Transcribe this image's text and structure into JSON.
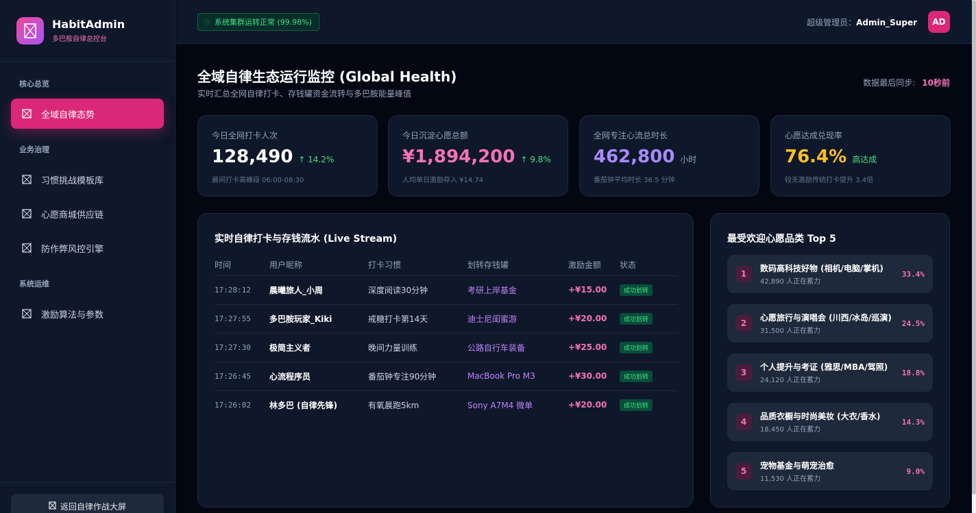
{
  "brand": {
    "title": "HabitAdmin",
    "subtitle": "多巴胺自律总控台"
  },
  "sidebar": {
    "sections": [
      "核心总览",
      "业务治理",
      "系统运维"
    ],
    "items": [
      {
        "label": "全域自律态势",
        "active": true
      },
      {
        "label": "习惯挑战模板库"
      },
      {
        "label": "心愿商城供应链"
      },
      {
        "label": "防作弊风控引擎"
      },
      {
        "label": "激励算法与参数"
      }
    ],
    "footer_button": "返回自律作战大屏"
  },
  "topbar": {
    "status": "系统集群运转正常 (99.98%)",
    "admin_label": "超级管理员：",
    "admin_name": "Admin_Super",
    "avatar": "AD"
  },
  "header": {
    "title": "全域自律生态运行监控 (Global Health)",
    "subtitle": "实时汇总全网自律打卡、存钱罐资金流转与多巴胺能量峰值",
    "sync_label": "数据最后同步:",
    "sync_value": "10秒前"
  },
  "kpis": [
    {
      "label": "今日全网打卡人次",
      "value": "128,490",
      "delta": "↑ 14.2%",
      "note": "晨间打卡高峰段 06:00-08:30",
      "color": "#ffffff",
      "delta_color": "#4ade80"
    },
    {
      "label": "今日沉淀心愿总额",
      "value": "¥1,894,200",
      "delta": "↑ 9.8%",
      "note": "人均单日激励存入 ¥14.74",
      "color": "#f472b6",
      "delta_color": "#4ade80"
    },
    {
      "label": "全网专注心流总时长",
      "value": "462,800",
      "delta": "小时",
      "note": "番茄钟平均时长 36.5 分钟",
      "color": "#a78bfa",
      "delta_color": "#94a3b8"
    },
    {
      "label": "心愿达成兑现率",
      "value": "76.4%",
      "delta": "高达成",
      "note": "较无激励传统打卡提升 3.4倍",
      "color": "#fbbf24",
      "delta_color": "#4ade80"
    }
  ],
  "stream": {
    "title": "实时自律打卡与存钱流水 (Live Stream)",
    "columns": [
      "时间",
      "用户昵称",
      "打卡习惯",
      "划转存钱罐",
      "激励金额",
      "状态"
    ],
    "rows": [
      {
        "time": "17:28:12",
        "user": "晨曦旅人_小周",
        "habit": "深度阅读30分钟",
        "jar": "考研上岸基金",
        "amount": "+¥15.00",
        "status": "成功划转"
      },
      {
        "time": "17:27:55",
        "user": "多巴胺玩家_Kiki",
        "habit": "戒糖打卡第14天",
        "jar": "迪士尼闺蜜游",
        "amount": "+¥20.00",
        "status": "成功划转"
      },
      {
        "time": "17:27:30",
        "user": "极简主义者",
        "habit": "晚间力量训练",
        "jar": "公路自行车装备",
        "amount": "+¥25.00",
        "status": "成功划转"
      },
      {
        "time": "17:26:45",
        "user": "心流程序员",
        "habit": "番茄钟专注90分钟",
        "jar": "MacBook Pro M3",
        "amount": "+¥30.00",
        "status": "成功划转"
      },
      {
        "time": "17:26:02",
        "user": "林多巴 (自律先锋)",
        "habit": "有氧晨跑5km",
        "jar": "Sony A7M4 微单",
        "amount": "+¥20.00",
        "status": "成功划转"
      }
    ]
  },
  "top5": {
    "title": "最受欢迎心愿品类 Top 5",
    "items": [
      {
        "rank": "1",
        "name": "数码高科技好物 (相机/电脑/掌机)",
        "sub": "42,890 人正在蓄力",
        "pct": "33.4%"
      },
      {
        "rank": "2",
        "name": "心愿旅行与演唱会 (川西/冰岛/巡演)",
        "sub": "31,500 人正在蓄力",
        "pct": "24.5%"
      },
      {
        "rank": "3",
        "name": "个人提升与考证 (雅思/MBA/驾照)",
        "sub": "24,120 人正在蓄力",
        "pct": "18.8%"
      },
      {
        "rank": "4",
        "name": "品质衣橱与时尚美妆 (大衣/香水)",
        "sub": "18,450 人正在蓄力",
        "pct": "14.3%"
      },
      {
        "rank": "5",
        "name": "宠物基金与萌宠治愈",
        "sub": "11,530 人正在蓄力",
        "pct": "9.0%"
      }
    ]
  }
}
